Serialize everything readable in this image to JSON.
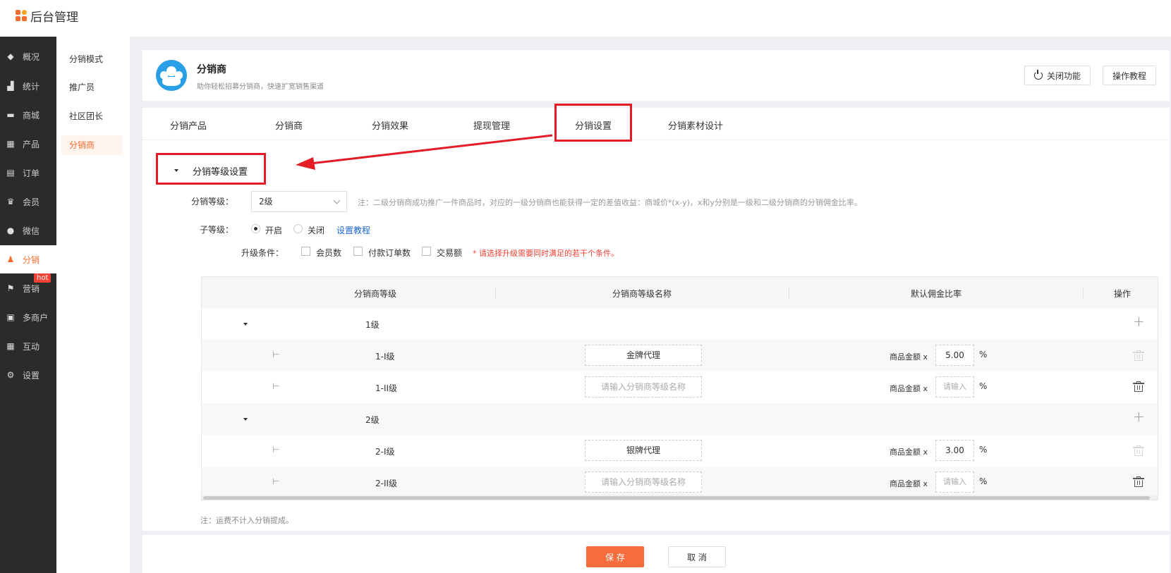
{
  "app": {
    "title": "后台管理"
  },
  "sidebar": {
    "items": [
      {
        "label": "概况",
        "icon": "layers-icon"
      },
      {
        "label": "统计",
        "icon": "chart-icon"
      },
      {
        "label": "商城",
        "icon": "shop-icon"
      },
      {
        "label": "产品",
        "icon": "grid-icon"
      },
      {
        "label": "订单",
        "icon": "order-icon"
      },
      {
        "label": "会员",
        "icon": "crown-icon"
      },
      {
        "label": "微信",
        "icon": "wechat-icon"
      },
      {
        "label": "分销",
        "icon": "user-share-icon",
        "active": true
      },
      {
        "label": "营销",
        "icon": "flag-icon",
        "badge": "hot"
      },
      {
        "label": "多商户",
        "icon": "store-icon"
      },
      {
        "label": "互动",
        "icon": "apps-icon"
      },
      {
        "label": "设置",
        "icon": "gear-icon"
      }
    ]
  },
  "submenu": {
    "items": [
      {
        "label": "分销模式"
      },
      {
        "label": "推广员"
      },
      {
        "label": "社区团长"
      },
      {
        "label": "分销商",
        "active": true
      }
    ]
  },
  "header": {
    "title": "分销商",
    "subtitle": "助你轻松招募分销商，快速扩宽销售渠道",
    "close_label": "关闭功能",
    "tutorial_label": "操作教程"
  },
  "tabs": [
    {
      "label": "分销产品"
    },
    {
      "label": "分销商"
    },
    {
      "label": "分销效果"
    },
    {
      "label": "提现管理"
    },
    {
      "label": "分销设置",
      "active": true
    },
    {
      "label": "分销素材设计"
    }
  ],
  "section": {
    "title": "分销等级设置",
    "level_label": "分销等级：",
    "level_value": "2级",
    "level_note": "注：二级分销商成功推广一件商品时，对应的一级分销商也能获得一定的差值收益：商城价*(x-y)，x和y分别是一级和二级分销商的分销佣金比率。",
    "sublevel_label": "子等级：",
    "on_label": "开启",
    "off_label": "关闭",
    "tutorial_link": "设置教程",
    "upgrade_label": "升级条件：",
    "cond_members": "会员数",
    "cond_orders": "付款订单数",
    "cond_amount": "交易额",
    "upgrade_warn": "* 请选择升级需要同时满足的若干个条件。"
  },
  "table": {
    "headers": [
      "分销商等级",
      "分销商等级名称",
      "默认佣金比率",
      "操作"
    ],
    "amount_label": "商品金额 x",
    "percent": "%",
    "name_placeholder": "请输入分销商等级名称",
    "rate_placeholder": "请输入",
    "rows": [
      {
        "type": "group",
        "level": "1级"
      },
      {
        "type": "sub",
        "level": "1-I级",
        "name": "金牌代理",
        "rate": "5.00"
      },
      {
        "type": "sub",
        "level": "1-II级",
        "name": "",
        "rate": ""
      },
      {
        "type": "group",
        "level": "2级"
      },
      {
        "type": "sub",
        "level": "2-I级",
        "name": "银牌代理",
        "rate": "3.00"
      },
      {
        "type": "sub",
        "level": "2-II级",
        "name": "",
        "rate": ""
      }
    ]
  },
  "footnote": "注：运费不计入分销提成。",
  "footer": {
    "save_label": "保 存",
    "cancel_label": "取 消"
  },
  "colors": {
    "accent": "#f56c2d",
    "annotation": "#e31c25",
    "link": "#1a66d6"
  }
}
